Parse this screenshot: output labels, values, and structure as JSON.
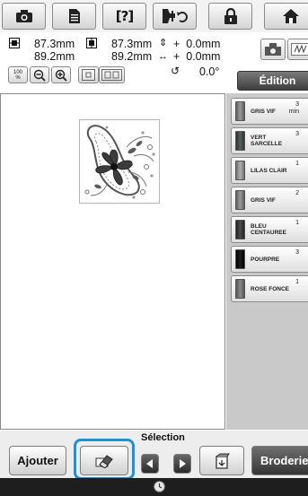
{
  "toolbar": {
    "icons": [
      "camera-icon",
      "document-icon",
      "help-icon",
      "needle-thread-icon",
      "lock-icon",
      "home-icon"
    ],
    "help_label": "[?]"
  },
  "info": {
    "width_icon": "width-size-icon",
    "line1_left": "87.3mm",
    "line2_left": "89.2mm",
    "height_icon": "height-size-icon",
    "line1_mid": "87.3mm",
    "line2_mid": "89.2mm",
    "v_move": "+  0.0mm",
    "h_move": "+  0.0mm",
    "rotation": "0.0°",
    "zoom_label": "100\n%",
    "edition_label": "Édition"
  },
  "threads": [
    {
      "name": "GRIS VIF",
      "value": "3\nmin",
      "color": "#8a8a8a"
    },
    {
      "name": "VERT\nSARCELLE",
      "value": "3",
      "color": "#3f4a48"
    },
    {
      "name": "LILAS CLAIR",
      "value": "1",
      "color": "#9a9a9a"
    },
    {
      "name": "GRIS VIF",
      "value": "2",
      "color": "#8a8a8a"
    },
    {
      "name": "BLEU\nCENTAUREE",
      "value": "1",
      "color": "#3a3a3a"
    },
    {
      "name": "POURPRE",
      "value": "3",
      "color": "#111111"
    },
    {
      "name": "ROSE FONCE",
      "value": "1",
      "color": "#7a7a7a"
    }
  ],
  "bottom": {
    "add_label": "Ajouter",
    "selection_label": "Sélection",
    "embroidery_label": "Broderie"
  },
  "colors": {
    "highlight": "#1e90d6",
    "panel": "#c9c9c9"
  }
}
